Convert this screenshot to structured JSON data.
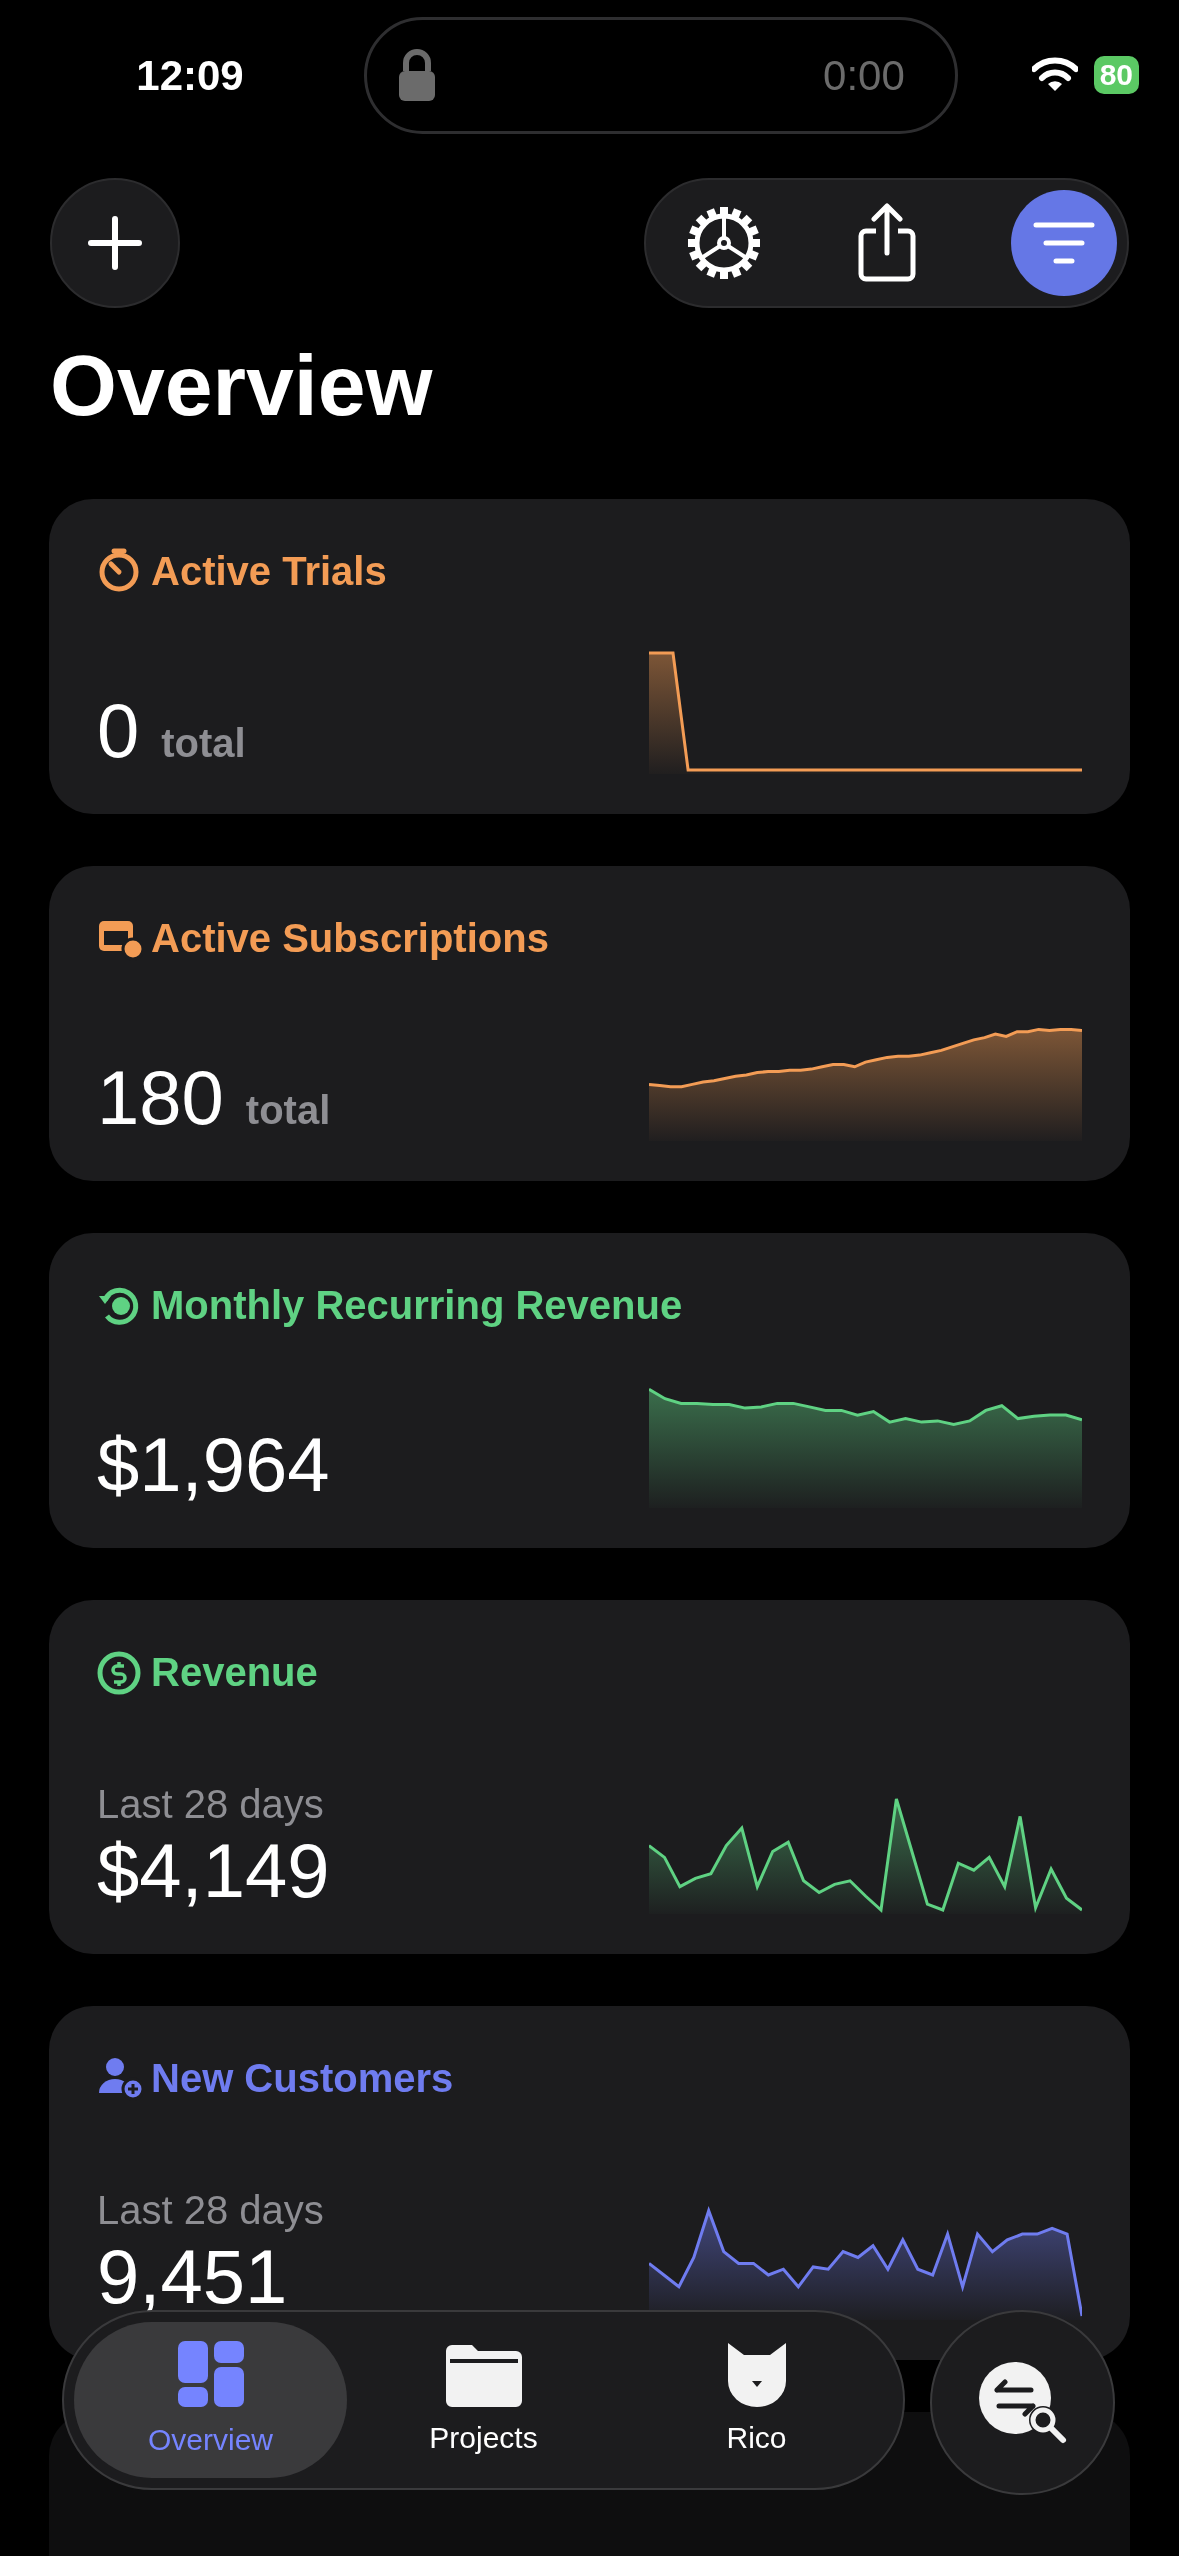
{
  "status_bar": {
    "time": "12:09",
    "live_activity_timer": "0:00",
    "battery": "80"
  },
  "toolbar": {
    "filter_active": true
  },
  "title": "Overview",
  "cards": [
    {
      "kind": "total",
      "title": "Active Trials",
      "color": "#f39c55",
      "value": "0",
      "unit": "total"
    },
    {
      "kind": "total",
      "title": "Active Subscriptions",
      "color": "#f39c55",
      "value": "180",
      "unit": "total"
    },
    {
      "kind": "plain",
      "title": "Monthly Recurring Revenue",
      "color": "#5fd283",
      "value": "$1,964"
    },
    {
      "kind": "period",
      "title": "Revenue",
      "color": "#5fd283",
      "subtitle": "Last 28 days",
      "value": "$4,149"
    },
    {
      "kind": "period",
      "title": "New Customers",
      "color": "#6f7cf0",
      "subtitle": "Last 28 days",
      "value": "9,451"
    },
    {
      "kind": "covered"
    }
  ],
  "tab_bar": {
    "tabs": [
      {
        "label": "Overview",
        "selected": true
      },
      {
        "label": "Projects",
        "selected": false
      },
      {
        "label": "Rico",
        "selected": false
      }
    ]
  }
}
